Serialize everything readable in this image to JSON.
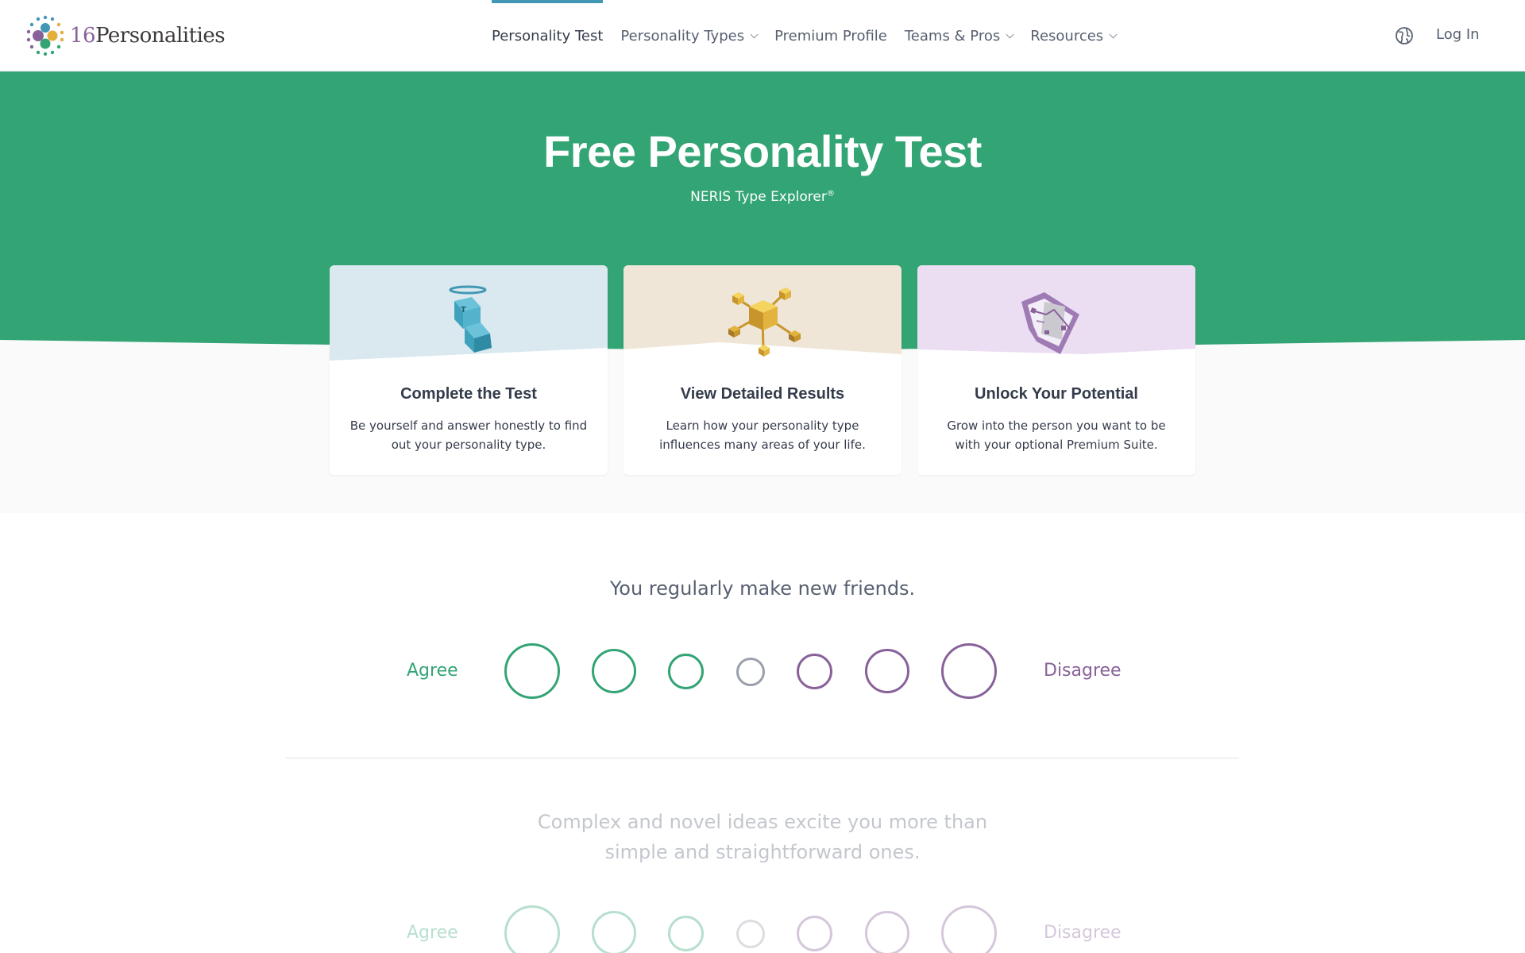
{
  "brand": {
    "number": "16",
    "name": "Personalities"
  },
  "nav": {
    "items": [
      {
        "label": "Personality Test",
        "active": true,
        "dropdown": false
      },
      {
        "label": "Personality Types",
        "active": false,
        "dropdown": true
      },
      {
        "label": "Premium Profile",
        "active": false,
        "dropdown": false
      },
      {
        "label": "Teams & Pros",
        "active": false,
        "dropdown": true
      },
      {
        "label": "Resources",
        "active": false,
        "dropdown": true
      }
    ],
    "language_icon": "globe-icon",
    "login_label": "Log In"
  },
  "hero": {
    "title": "Free Personality Test",
    "subtitle": "NERIS Type Explorer",
    "subtitle_mark": "®"
  },
  "cards": [
    {
      "title": "Complete the Test",
      "text": "Be yourself and answer honestly to find out your personality type.",
      "color": "#d9e9ef"
    },
    {
      "title": "View Detailed Results",
      "text": "Learn how your personality type influences many areas of your life.",
      "color": "#efe6d8"
    },
    {
      "title": "Unlock Your Potential",
      "text": "Grow into the person you want to be with your optional Premium Suite.",
      "color": "#ebdef3"
    }
  ],
  "questions": [
    {
      "text": "You regularly make new friends.",
      "agree": "Agree",
      "disagree": "Disagree",
      "active": true
    },
    {
      "text": "Complex and novel ideas excite you more than simple and straightforward ones.",
      "agree": "Agree",
      "disagree": "Disagree",
      "active": false
    }
  ],
  "colors": {
    "green": "#33a474",
    "purple": "#88619a",
    "blue": "#4298b4",
    "neutral": "#9aa0ab"
  }
}
